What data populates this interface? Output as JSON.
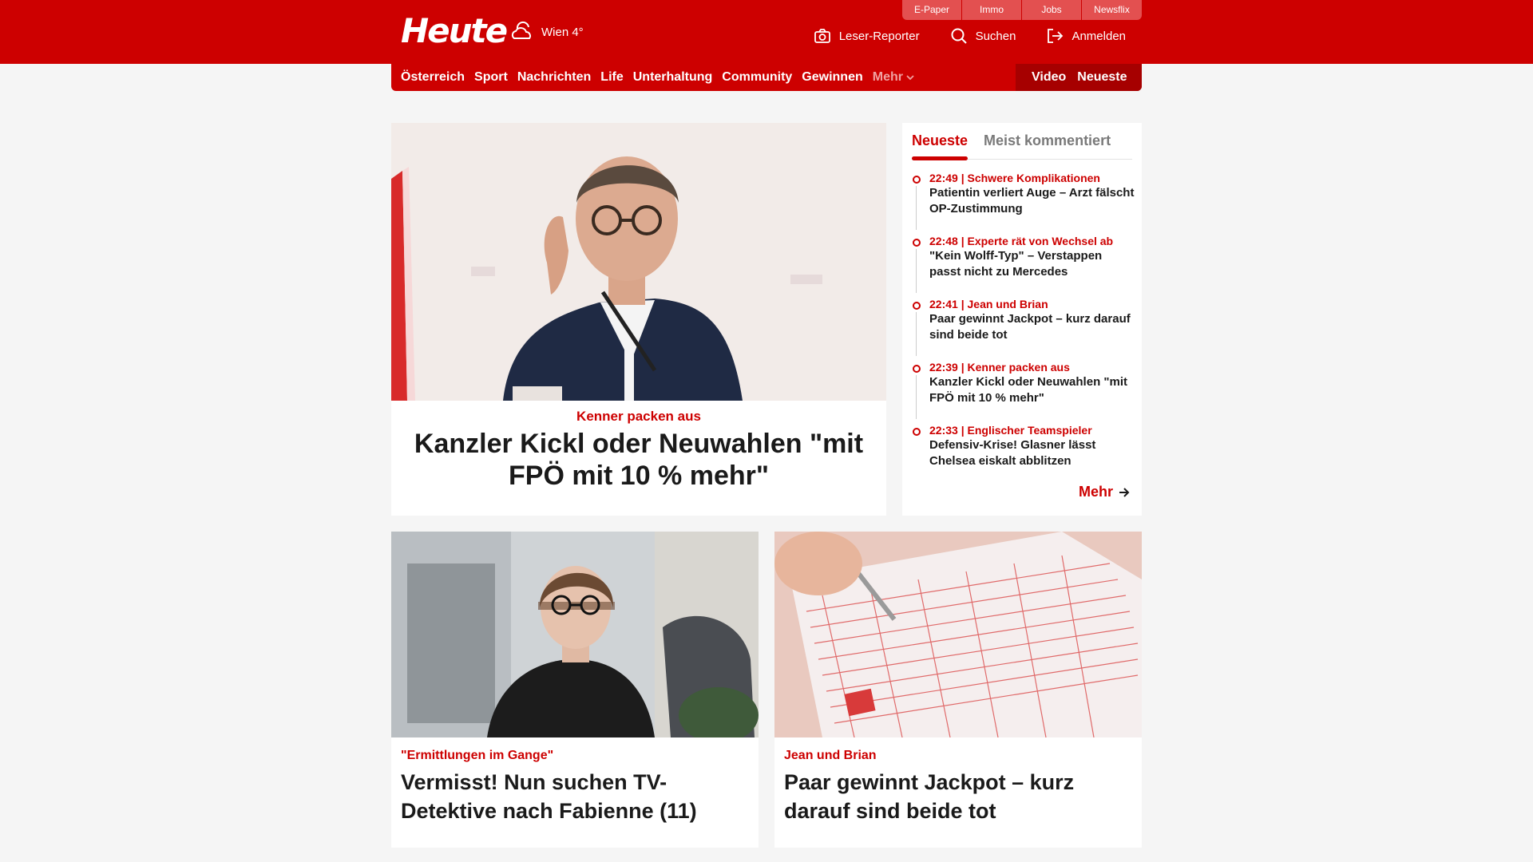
{
  "header": {
    "logo": "Heute",
    "weather": {
      "city_temp": "Wien 4°",
      "icon": "cloud-sun-icon"
    },
    "service_tabs": [
      "E-Paper",
      "Immo",
      "Jobs",
      "Newsflix"
    ],
    "actions": [
      {
        "label": "Leser-Reporter",
        "icon": "camera-icon"
      },
      {
        "label": "Suchen",
        "icon": "search-icon"
      },
      {
        "label": "Anmelden",
        "icon": "login-icon"
      }
    ]
  },
  "nav": {
    "items": [
      "Österreich",
      "Sport",
      "Nachrichten",
      "Life",
      "Unterhaltung",
      "Community",
      "Gewinnen"
    ],
    "more_label": "Mehr",
    "right_items": [
      "Video",
      "Neueste"
    ]
  },
  "main_story": {
    "kicker": "Kenner packen aus",
    "title": "Kanzler Kickl oder Neuwahlen \"mit FPÖ mit 10 % mehr\""
  },
  "sidebar": {
    "tabs": [
      "Neueste",
      "Meist kommentiert"
    ],
    "items": [
      {
        "meta": "22:49 | Schwere Komplikationen",
        "title": "Patientin verliert Auge – Arzt fälscht OP-Zustimmung"
      },
      {
        "meta": "22:48 | Experte rät von Wechsel ab",
        "title": "\"Kein Wolff-Typ\" – Verstappen passt nicht zu Mercedes"
      },
      {
        "meta": "22:41 | Jean und Brian",
        "title": "Paar gewinnt Jackpot – kurz darauf sind beide tot"
      },
      {
        "meta": "22:39 | Kenner packen aus",
        "title": "Kanzler Kickl oder Neuwahlen \"mit FPÖ mit 10 % mehr\""
      },
      {
        "meta": "22:33 | Englischer Teamspieler",
        "title": "Defensiv-Krise! Glasner lässt Chelsea eiskalt abblitzen"
      }
    ],
    "more_label": "Mehr"
  },
  "cards": [
    {
      "kicker": "\"Ermittlungen im Gange\"",
      "title": "Vermisst! Nun suchen TV-Detektive nach Fabienne (11)"
    },
    {
      "kicker": "Jean und Brian",
      "title": "Paar gewinnt Jackpot – kurz darauf sind beide tot"
    }
  ],
  "colors": {
    "brand": "#cd0000",
    "brand_dark": "#a60000",
    "background": "#f5f5f5"
  }
}
